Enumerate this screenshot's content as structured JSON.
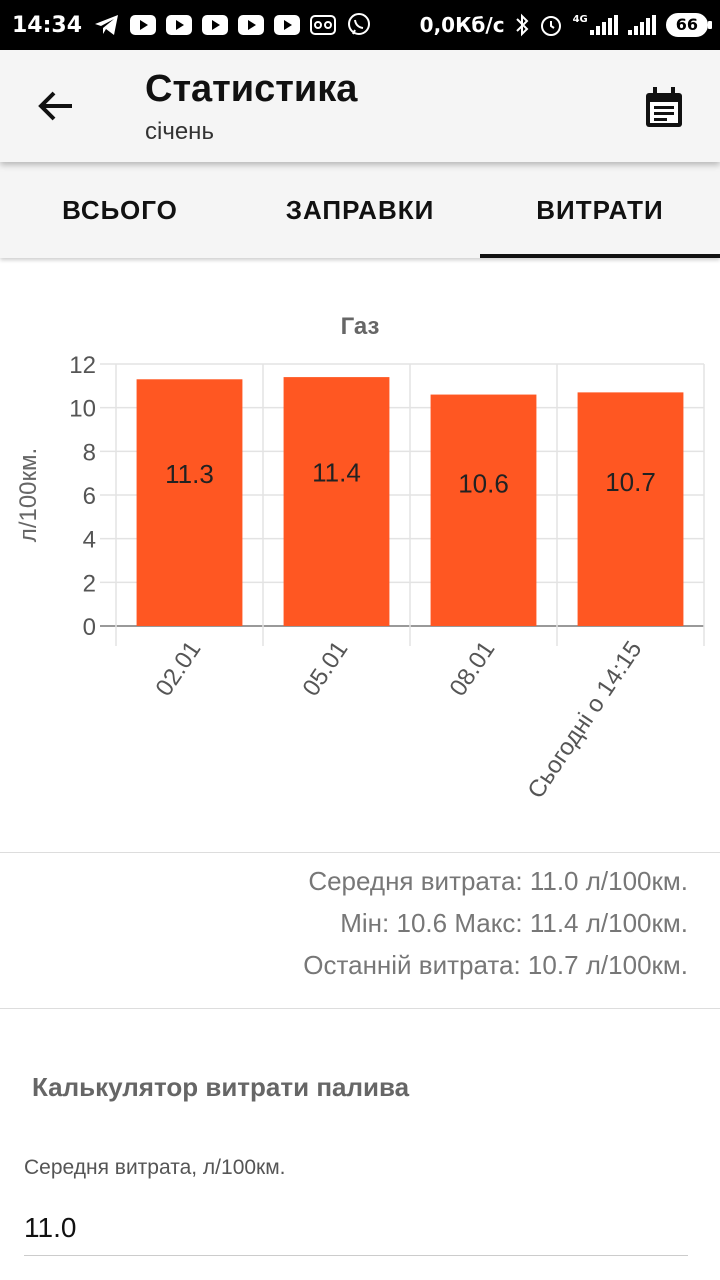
{
  "status_bar": {
    "time": "14:34",
    "net_speed": "0,0Кб/с",
    "signal_label": "4G",
    "battery": "66"
  },
  "header": {
    "title": "Статистика",
    "subtitle": "січень",
    "back_icon": "arrow-left-icon",
    "calendar_icon": "calendar-icon"
  },
  "tabs": [
    {
      "label": "ВСЬОГО",
      "active": false
    },
    {
      "label": "ЗАПРАВКИ",
      "active": false
    },
    {
      "label": "ВИТРАТИ",
      "active": true
    }
  ],
  "chart_data": {
    "type": "bar",
    "title": "Газ",
    "ylabel": "л/100км.",
    "xlabel": "",
    "categories": [
      "02.01",
      "05.01",
      "08.01",
      "Сьогодні о 14:15"
    ],
    "values": [
      11.3,
      11.4,
      10.6,
      10.7
    ],
    "value_labels": [
      "11.3",
      "11.4",
      "10.6",
      "10.7"
    ],
    "ylim": [
      0,
      12
    ],
    "yticks": [
      0,
      2,
      4,
      6,
      8,
      10,
      12
    ],
    "grid": true,
    "bar_color": "#ff5722"
  },
  "stats": {
    "average": "Середня витрата: 11.0 л/100км.",
    "minmax": "Мін: 10.6 Макс: 11.4 л/100км.",
    "last": "Останній витрата: 10.7 л/100км."
  },
  "calculator": {
    "title": "Калькулятор витрати палива",
    "avg_label": "Середня витрата, л/100км.",
    "avg_value": "11.0"
  }
}
